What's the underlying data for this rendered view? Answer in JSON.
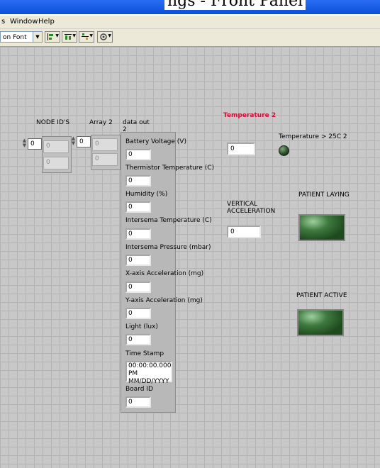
{
  "window": {
    "title_fragment": "ngs - Front Panel"
  },
  "menu": {
    "items": [
      {
        "label": "s",
        "name": "menu-partial"
      },
      {
        "label": "Window",
        "name": "menu-window"
      },
      {
        "label": "Help",
        "name": "menu-help"
      }
    ]
  },
  "toolbar": {
    "font_label": "on Font",
    "buttons": [
      "align-icon",
      "distribute-icon",
      "resize-icon",
      "reorder-icon"
    ]
  },
  "panel": {
    "node_ids": {
      "label": "NODE ID'S",
      "index": "0",
      "values": [
        "0",
        "0"
      ]
    },
    "array2": {
      "label": "Array 2",
      "index": "0",
      "values": [
        "0",
        "0"
      ]
    },
    "data_out": {
      "label": "data out",
      "sub_label": "2",
      "fields": [
        {
          "label": "Battery Voltage (V)",
          "value": "0"
        },
        {
          "label": "Thermistor Temperature (C)",
          "value": "0"
        },
        {
          "label": "Humidity (%)",
          "value": "0"
        },
        {
          "label": "Intersema Temperature (C)",
          "value": "0"
        },
        {
          "label": "Intersema Pressure (mbar)",
          "value": "0"
        },
        {
          "label": "X-axis Acceleration (mg)",
          "value": "0"
        },
        {
          "label": "Y-axis Acceleration (mg)",
          "value": "0"
        },
        {
          "label": "Light (lux)",
          "value": "0"
        }
      ],
      "time_stamp": {
        "label": "Time Stamp",
        "line1": "00:00:00.000 PM",
        "line2": "MM/DD/YYYY"
      },
      "board_id": {
        "label": "Board ID",
        "value": "0"
      }
    },
    "temperature2": {
      "label": "Temperature 2",
      "value": "0",
      "label_color": "#d0103a"
    },
    "temp_led": {
      "label": "Temperature > 25C 2"
    },
    "vertical_accel": {
      "label_line1": "VERTICAL",
      "label_line2": "ACCELERATION",
      "value": "0"
    },
    "patient_laying": {
      "label": "PATIENT LAYING"
    },
    "patient_active": {
      "label": "PATIENT ACTIVE"
    }
  }
}
